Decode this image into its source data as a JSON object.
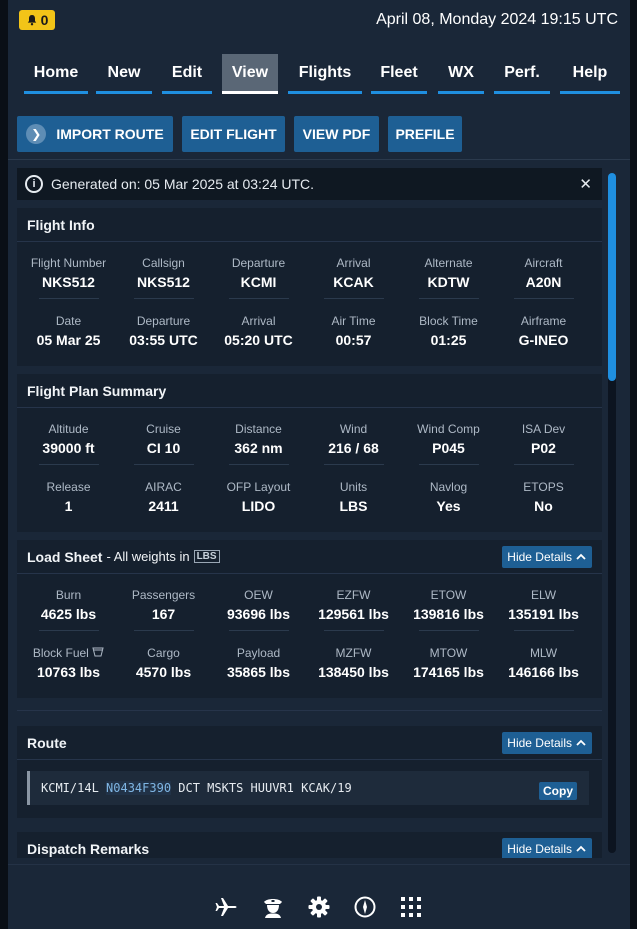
{
  "header": {
    "alert_count": "0",
    "datetime": "April 08, Monday 2024 19:15 UTC"
  },
  "nav": {
    "items": [
      {
        "label": "Home"
      },
      {
        "label": "New"
      },
      {
        "label": "Edit"
      },
      {
        "label": "View"
      },
      {
        "label": "Flights"
      },
      {
        "label": "Fleet"
      },
      {
        "label": "WX"
      },
      {
        "label": "Perf."
      },
      {
        "label": "Help"
      }
    ],
    "active": "View"
  },
  "actions": {
    "import_route": "IMPORT ROUTE",
    "edit_flight": "EDIT FLIGHT",
    "view_pdf": "VIEW PDF",
    "prefile": "PREFILE"
  },
  "notice": {
    "text": "Generated on: 05 Mar 2025 at 03:24 UTC."
  },
  "flight_info": {
    "title": "Flight Info",
    "rows": [
      [
        {
          "label": "Flight Number",
          "value": "NKS512"
        },
        {
          "label": "Callsign",
          "value": "NKS512"
        },
        {
          "label": "Departure",
          "value": "KCMI"
        },
        {
          "label": "Arrival",
          "value": "KCAK"
        },
        {
          "label": "Alternate",
          "value": "KDTW"
        },
        {
          "label": "Aircraft",
          "value": "A20N"
        }
      ],
      [
        {
          "label": "Date",
          "value": "05 Mar 25"
        },
        {
          "label": "Departure",
          "value": "03:55 UTC"
        },
        {
          "label": "Arrival",
          "value": "05:20 UTC"
        },
        {
          "label": "Air Time",
          "value": "00:57"
        },
        {
          "label": "Block Time",
          "value": "01:25"
        },
        {
          "label": "Airframe",
          "value": "G-INEO"
        }
      ]
    ]
  },
  "plan_summary": {
    "title": "Flight Plan Summary",
    "rows": [
      [
        {
          "label": "Altitude",
          "value": "39000 ft"
        },
        {
          "label": "Cruise",
          "value": "CI 10"
        },
        {
          "label": "Distance",
          "value": "362 nm"
        },
        {
          "label": "Wind",
          "value": "216 / 68"
        },
        {
          "label": "Wind Comp",
          "value": "P045"
        },
        {
          "label": "ISA Dev",
          "value": "P02"
        }
      ],
      [
        {
          "label": "Release",
          "value": "1"
        },
        {
          "label": "AIRAC",
          "value": "2411"
        },
        {
          "label": "OFP Layout",
          "value": "LIDO"
        },
        {
          "label": "Units",
          "value": "LBS"
        },
        {
          "label": "Navlog",
          "value": "Yes"
        },
        {
          "label": "ETOPS",
          "value": "No"
        }
      ]
    ]
  },
  "load_sheet": {
    "title": "Load Sheet",
    "subtitle": "- All weights in",
    "unit_tag": "LBS",
    "hide_label": "Hide Details",
    "rows": [
      [
        {
          "label": "Burn",
          "value": "4625 lbs"
        },
        {
          "label": "Passengers",
          "value": "167"
        },
        {
          "label": "OEW",
          "value": "93696 lbs"
        },
        {
          "label": "EZFW",
          "value": "129561 lbs"
        },
        {
          "label": "ETOW",
          "value": "139816 lbs"
        },
        {
          "label": "ELW",
          "value": "135191 lbs"
        }
      ],
      [
        {
          "label": "Block Fuel",
          "value": "10763 lbs"
        },
        {
          "label": "Cargo",
          "value": "4570 lbs"
        },
        {
          "label": "Payload",
          "value": "35865 lbs"
        },
        {
          "label": "MZFW",
          "value": "138450 lbs"
        },
        {
          "label": "MTOW",
          "value": "174165 lbs"
        },
        {
          "label": "MLW",
          "value": "146166 lbs"
        }
      ]
    ]
  },
  "route": {
    "title": "Route",
    "hide_label": "Hide Details",
    "pre": "KCMI/14L ",
    "highlight": "N0434F390",
    "post": " DCT MSKTS HUUVR1 KCAK/19",
    "copy_label": "Copy"
  },
  "remarks": {
    "title": "Dispatch Remarks",
    "hide_label": "Hide Details"
  },
  "colors": {
    "accent": "#1f8fe0",
    "button": "#1e5f94",
    "alert": "#f2c418"
  }
}
